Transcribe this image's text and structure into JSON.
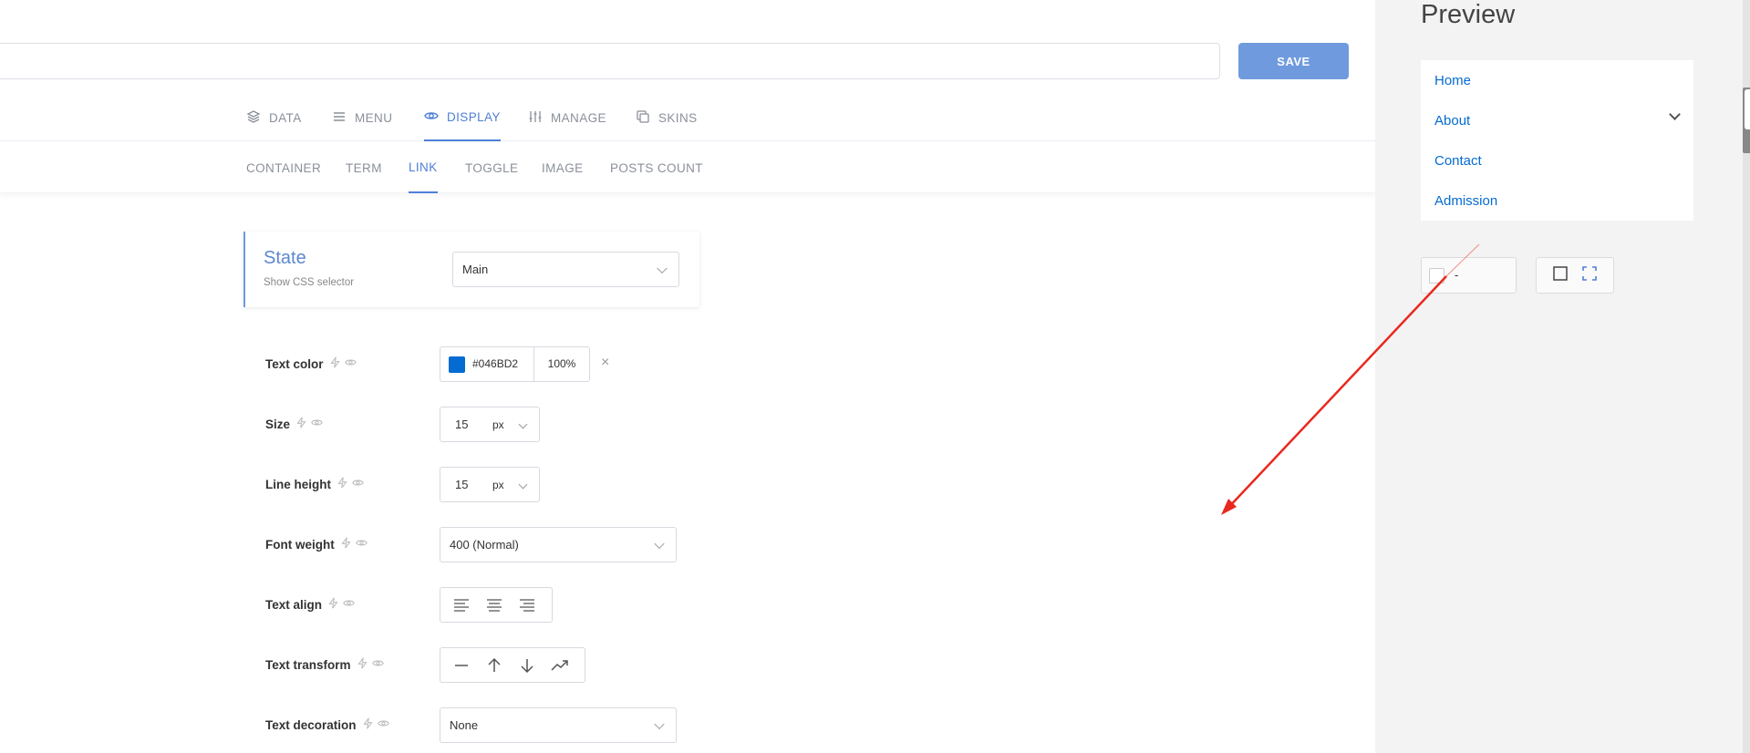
{
  "toolbar": {
    "save_label": "SAVE"
  },
  "tabs": [
    {
      "label": "DATA",
      "icon": "layers-icon"
    },
    {
      "label": "MENU",
      "icon": "menu-lines-icon"
    },
    {
      "label": "DISPLAY",
      "icon": "eye-icon",
      "active": true
    },
    {
      "label": "MANAGE",
      "icon": "sliders-icon"
    },
    {
      "label": "SKINS",
      "icon": "copy-icon"
    }
  ],
  "subtabs": [
    {
      "label": "CONTAINER"
    },
    {
      "label": "TERM"
    },
    {
      "label": "LINK",
      "active": true
    },
    {
      "label": "TOGGLE"
    },
    {
      "label": "IMAGE"
    },
    {
      "label": "POSTS COUNT"
    }
  ],
  "state": {
    "title": "State",
    "subtitle": "Show CSS selector",
    "value": "Main"
  },
  "fields": {
    "text_color": {
      "label": "Text color",
      "hex": "#046BD2",
      "opacity": "100%",
      "clear": "×"
    },
    "size": {
      "label": "Size",
      "value": "15",
      "unit": "px"
    },
    "line_height": {
      "label": "Line height",
      "value": "15",
      "unit": "px"
    },
    "font_weight": {
      "label": "Font weight",
      "value": "400 (Normal)"
    },
    "text_align": {
      "label": "Text align"
    },
    "text_transform": {
      "label": "Text transform"
    },
    "text_decoration": {
      "label": "Text decoration",
      "value": "None"
    }
  },
  "preview": {
    "title": "Preview",
    "menu_items": [
      "Home",
      "About",
      "Contact",
      "Admission"
    ],
    "control_value": "-"
  },
  "colors": {
    "accent": "#4f7fd6",
    "link": "#046BD2",
    "save_bg": "#6f9ade",
    "annotation": "#e8281e"
  }
}
